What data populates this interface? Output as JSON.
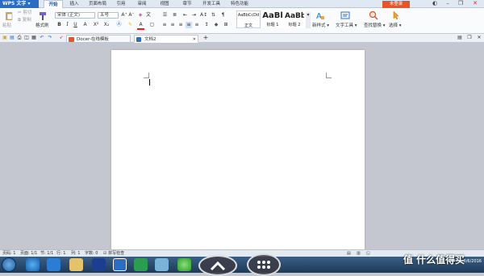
{
  "app": {
    "name": "WPS 文字",
    "login_label": "未登录"
  },
  "menu_tabs": [
    "开始",
    "插入",
    "页面布局",
    "引用",
    "审阅",
    "视图",
    "章节",
    "开发工具",
    "特色功能"
  ],
  "clipboard": {
    "paste": "粘贴",
    "cut": "剪切",
    "copy": "复制",
    "format_painter": "格式刷"
  },
  "font": {
    "family": "宋体 (正文)",
    "size": "五号",
    "buttons": [
      "B",
      "I",
      "U",
      "A",
      "X²",
      "X₂"
    ]
  },
  "styles": [
    {
      "preview": "AaBbCcDd",
      "label": "正文"
    },
    {
      "preview": "AaBl",
      "label": "标题 1"
    },
    {
      "preview": "AaBb(",
      "label": "标题 2"
    }
  ],
  "ribbon_right": {
    "new_style": "新样式",
    "text_tools": "文字工具",
    "find_replace": "查找替换",
    "select": "选择"
  },
  "doc_tabs": [
    {
      "label": "Docer-在线模板",
      "icon": "docer-icon"
    },
    {
      "label": "文档2",
      "icon": "doc-icon"
    }
  ],
  "add_tab": "+",
  "status": {
    "page": "页码: 1",
    "pages": "页面: 1/1",
    "section": "节: 1/1",
    "row": "行: 1",
    "col": "列: 1",
    "words": "字数: 0",
    "spell": "拼写检查"
  },
  "clock": {
    "time": "",
    "date": "3/6/2016"
  },
  "watermark": "值 什么值得买",
  "colors": {
    "accent": "#2b6cc4",
    "login": "#e8542a",
    "taskbar": "#2a4a6e"
  }
}
